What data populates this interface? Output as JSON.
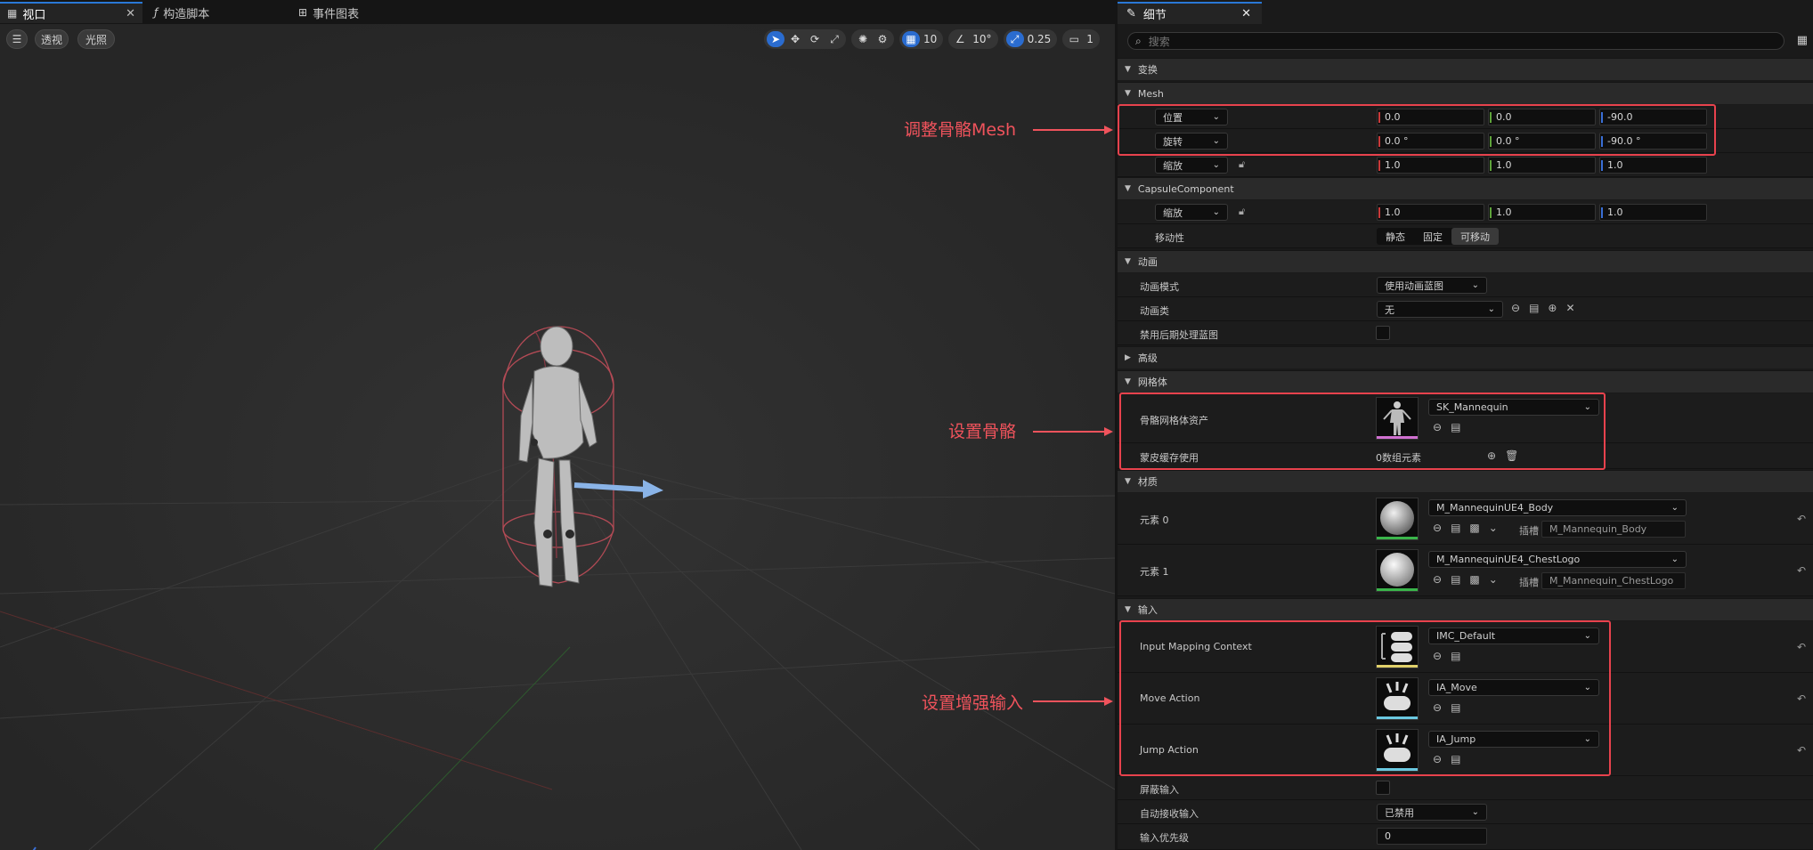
{
  "tabs": [
    {
      "label": "视口",
      "icon": "viewport-icon",
      "active": true
    },
    {
      "label": "构造脚本",
      "icon": "function-icon",
      "active": false
    },
    {
      "label": "事件图表",
      "icon": "event-graph-icon",
      "active": false
    }
  ],
  "viewport": {
    "perspective_label": "透视",
    "lit_label": "光照",
    "grid_snap": "10",
    "rotation_snap": "10°",
    "scale_snap": "0.25",
    "camera_speed": "1"
  },
  "annotations": {
    "mesh": "调整骨骼Mesh",
    "skeleton": "设置骨骼",
    "input": "设置增强输入"
  },
  "details": {
    "tab_label": "细节",
    "search_placeholder": "搜索",
    "categories": {
      "transform": "变换",
      "mesh": "Mesh",
      "capsule": "CapsuleComponent",
      "animation": "动画",
      "advanced": "高级",
      "mesh_group": "网格体",
      "materials": "材质",
      "input": "输入"
    },
    "mesh": {
      "location_label": "位置",
      "location": [
        "0.0",
        "0.0",
        "-90.0"
      ],
      "rotation_label": "旋转",
      "rotation": [
        "0.0 °",
        "0.0 °",
        "-90.0 °"
      ],
      "scale_label": "缩放",
      "scale": [
        "1.0",
        "1.0",
        "1.0"
      ]
    },
    "capsule": {
      "scale_label": "缩放",
      "scale": [
        "1.0",
        "1.0",
        "1.0"
      ],
      "mobility_label": "移动性",
      "mobility_options": [
        "静态",
        "固定",
        "可移动"
      ]
    },
    "animation": {
      "mode_label": "动画模式",
      "mode_value": "使用动画蓝图",
      "class_label": "动画类",
      "class_value": "无",
      "disable_post_label": "禁用后期处理蓝图"
    },
    "mesh_group": {
      "asset_label": "骨骼网格体资产",
      "asset_value": "SK_Mannequin",
      "skin_cache_label": "蒙皮缓存使用",
      "skin_cache_value": "0数组元素"
    },
    "materials": {
      "slot_prefix": "插槽",
      "items": [
        {
          "label": "元素 0",
          "value": "M_MannequinUE4_Body",
          "slot": "M_Mannequin_Body"
        },
        {
          "label": "元素 1",
          "value": "M_MannequinUE4_ChestLogo",
          "slot": "M_Mannequin_ChestLogo"
        }
      ]
    },
    "input": {
      "imc_label": "Input Mapping Context",
      "imc_value": "IMC_Default",
      "move_label": "Move Action",
      "move_value": "IA_Move",
      "jump_label": "Jump Action",
      "jump_value": "IA_Jump",
      "block_label": "屏蔽输入",
      "auto_label": "自动接收输入",
      "auto_value": "已禁用",
      "priority_label": "输入优先级",
      "priority_value": "0"
    }
  },
  "colors": {
    "accent": "#2a78d6",
    "annotation": "#e8424d",
    "thumb_mesh": "#d070d0",
    "thumb_material": "#3ab54a",
    "thumb_imc": "#e0d06a",
    "thumb_action": "#6ac8e0"
  }
}
